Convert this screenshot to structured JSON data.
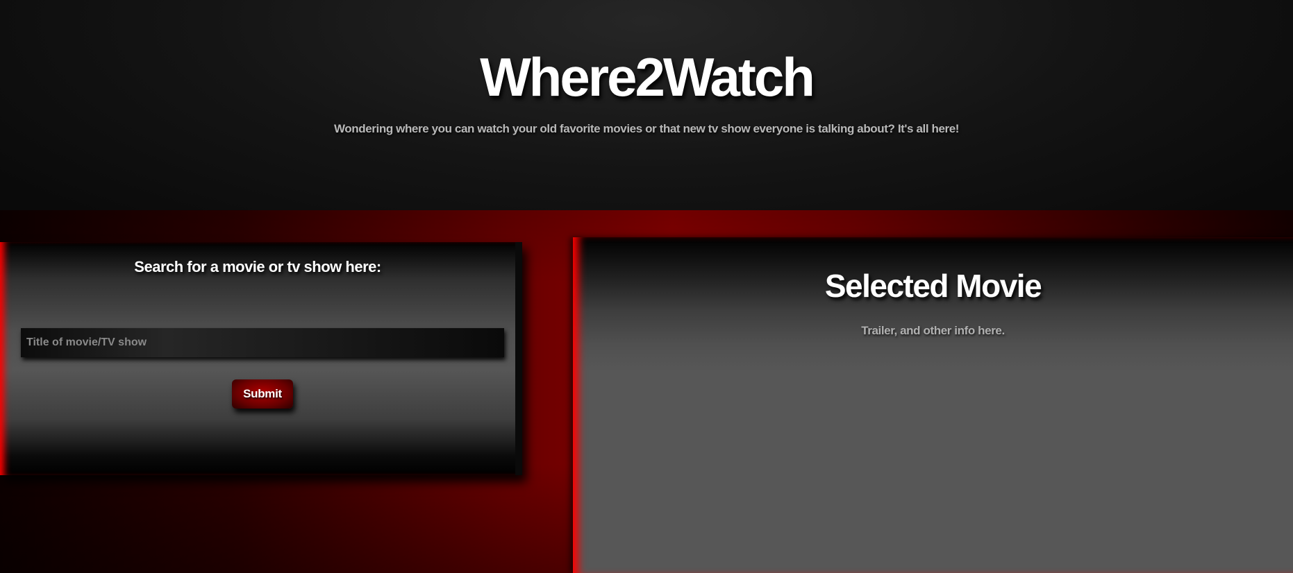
{
  "header": {
    "title": "Where2Watch",
    "tagline": "Wondering where you can watch your old favorite movies or that new tv show everyone is talking about? It's all here!"
  },
  "search": {
    "heading": "Search for a movie or tv show here:",
    "input_value": "",
    "placeholder": "Title of movie/TV show",
    "submit_label": "Submit"
  },
  "selected": {
    "title": "Selected Movie",
    "info": "Trailer, and other info here."
  },
  "colors": {
    "accent": "#8b0000",
    "highlight": "#ff0000",
    "panel": "#555555",
    "header_bg": "#1a1a1a"
  }
}
